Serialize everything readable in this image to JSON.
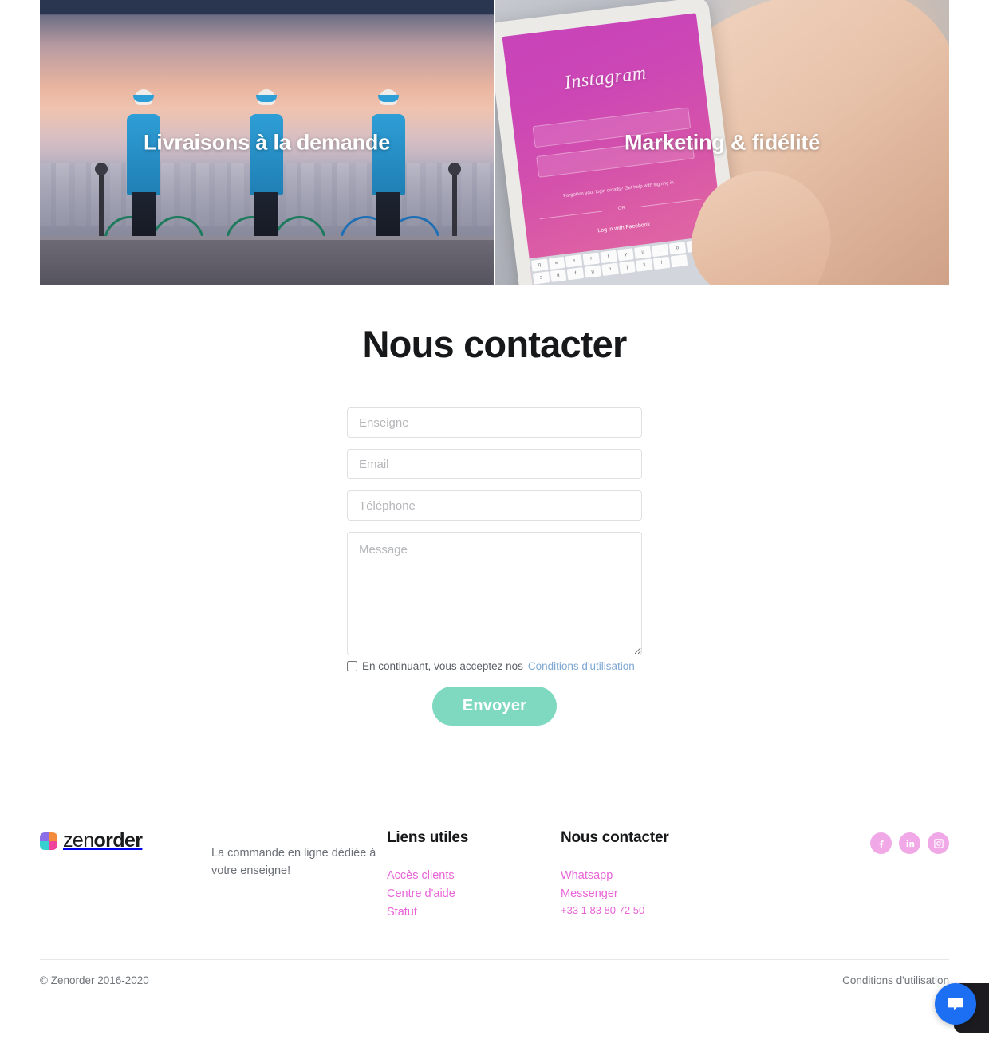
{
  "hero": {
    "cards": [
      {
        "label": "Livraisons à la demande",
        "image_alt": "stuart-cyclists-photo"
      },
      {
        "label": "Marketing & fidélité",
        "image_alt": "instagram-phone-photo"
      }
    ]
  },
  "contact": {
    "title": "Nous contacter",
    "fields": {
      "enseigne_placeholder": "Enseigne",
      "enseigne_value": "",
      "email_placeholder": "Email",
      "email_value": "",
      "telephone_placeholder": "Téléphone",
      "telephone_value": "",
      "message_placeholder": "Message",
      "message_value": ""
    },
    "consent_text": "En continuant, vous acceptez nos",
    "consent_link": "Conditions d'utilisation",
    "submit_label": "Envoyer",
    "accent_color": "#7fd8c0",
    "link_color": "#7fa8d4"
  },
  "footer": {
    "brand": {
      "name_light": "zen",
      "name_bold": "order"
    },
    "tagline": "La commande en ligne dédiée à votre enseigne!",
    "columns": [
      {
        "heading": "Liens utiles",
        "links": [
          "Accès clients",
          "Centre d'aide",
          "Statut"
        ]
      },
      {
        "heading": "Nous contacter",
        "links": [
          "Whatsapp",
          "Messenger"
        ],
        "phone": "+33 1 83 80 72 50"
      }
    ],
    "social": [
      {
        "name": "facebook-icon",
        "glyph": "f"
      },
      {
        "name": "linkedin-icon",
        "glyph": "in"
      },
      {
        "name": "instagram-icon",
        "glyph": "ig"
      }
    ],
    "social_color": "#f0a9e6",
    "link_color": "#e964d8",
    "bottom": {
      "copyright": "© Zenorder 2016-2020",
      "terms": "Conditions d'utilisation"
    }
  },
  "chat": {
    "icon": "chat-bubble-icon",
    "color": "#1c6ff2"
  }
}
